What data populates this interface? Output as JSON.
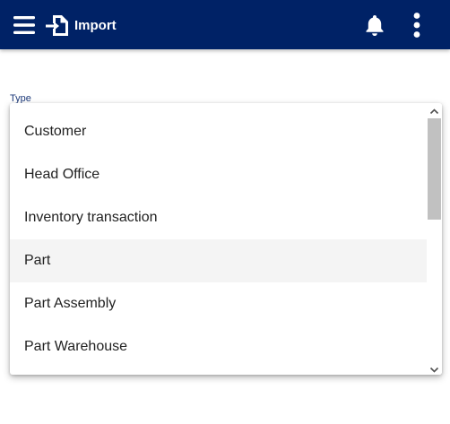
{
  "header": {
    "title": "Import",
    "background_color": "#002266",
    "icons": {
      "menu": "hamburger-menu-icon",
      "import": "import-file-icon",
      "notifications": "bell-icon",
      "more": "vertical-dots-icon"
    }
  },
  "form": {
    "type_label": "Type"
  },
  "dropdown": {
    "options": [
      {
        "label": "Customer",
        "highlighted": false
      },
      {
        "label": "Head Office",
        "highlighted": false
      },
      {
        "label": "Inventory transaction",
        "highlighted": false
      },
      {
        "label": "Part",
        "highlighted": true
      },
      {
        "label": "Part Assembly",
        "highlighted": false
      },
      {
        "label": "Part Warehouse",
        "highlighted": false
      }
    ]
  }
}
